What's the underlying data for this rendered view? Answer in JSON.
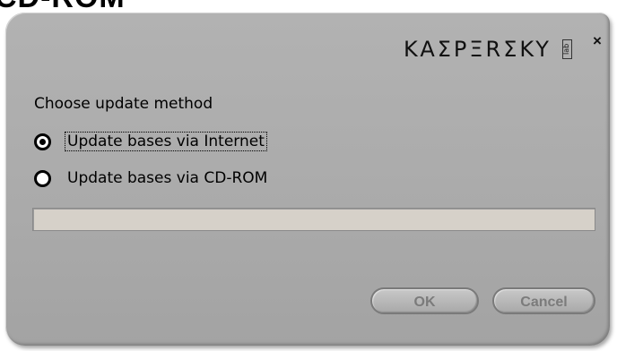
{
  "background_heading": "CD-ROM",
  "dialog": {
    "brand": "KAΣPΞRΣKY",
    "brand_sub": "lab",
    "close_label": "×",
    "section_label": "Choose update method",
    "options": [
      {
        "label": "Update bases via Internet",
        "selected": true
      },
      {
        "label": "Update bases via CD-ROM",
        "selected": false
      }
    ],
    "buttons": {
      "ok": "OK",
      "cancel": "Cancel"
    }
  },
  "colors": {
    "dialog_bg": "#aaaaaa",
    "progress_bg": "#d6d1c9",
    "button_text_disabled": "#7b7b7b"
  }
}
